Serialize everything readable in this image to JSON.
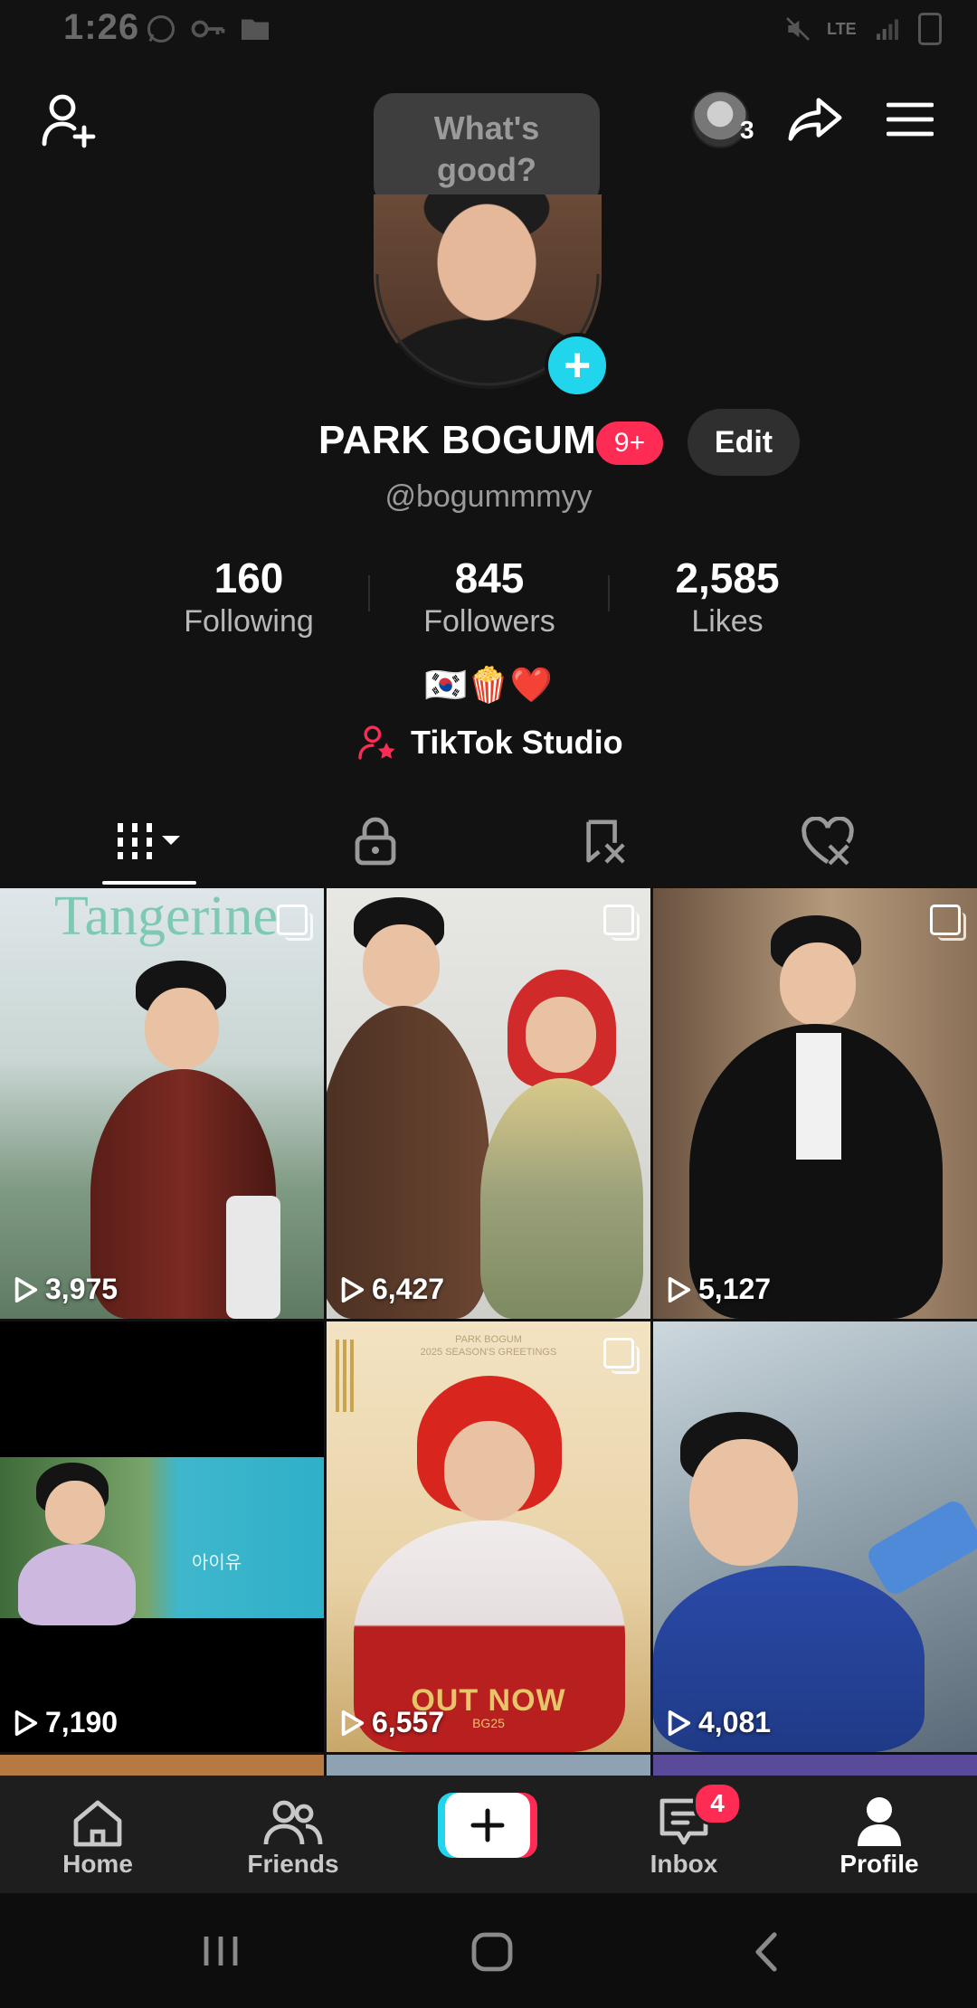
{
  "status_bar": {
    "time": "1:26",
    "network": "LTE"
  },
  "tooltip": {
    "text": "What's good?"
  },
  "story": {
    "count": "3"
  },
  "profile": {
    "name": "PARK BOGUM",
    "notification_badge": "9+",
    "edit_label": "Edit",
    "handle": "@bogummmyy",
    "bio": "🇰🇷🍿❤️",
    "studio_label": "TikTok Studio"
  },
  "stats": [
    {
      "value": "160",
      "label": "Following"
    },
    {
      "value": "845",
      "label": "Followers"
    },
    {
      "value": "2,585",
      "label": "Likes"
    }
  ],
  "videos": [
    {
      "views": "3,975",
      "caption": "Tangerine",
      "multi": true
    },
    {
      "views": "6,427",
      "caption": "",
      "multi": true
    },
    {
      "views": "5,127",
      "caption": "",
      "multi": true
    },
    {
      "views": "7,190",
      "caption": "아이유",
      "multi": false
    },
    {
      "views": "6,557",
      "caption": "OUT NOW",
      "caption_top": "PARK BOGUM",
      "caption_top2": "2025 SEASON'S GREETINGS",
      "caption_small": "BG25",
      "multi": true
    },
    {
      "views": "4,081",
      "caption": "",
      "multi": false
    }
  ],
  "bottom_nav": {
    "home": "Home",
    "friends": "Friends",
    "inbox": "Inbox",
    "inbox_badge": "4",
    "profile": "Profile"
  },
  "colors": {
    "accent": "#fe2c55",
    "cyan": "#20d5ec",
    "background": "#121212"
  }
}
